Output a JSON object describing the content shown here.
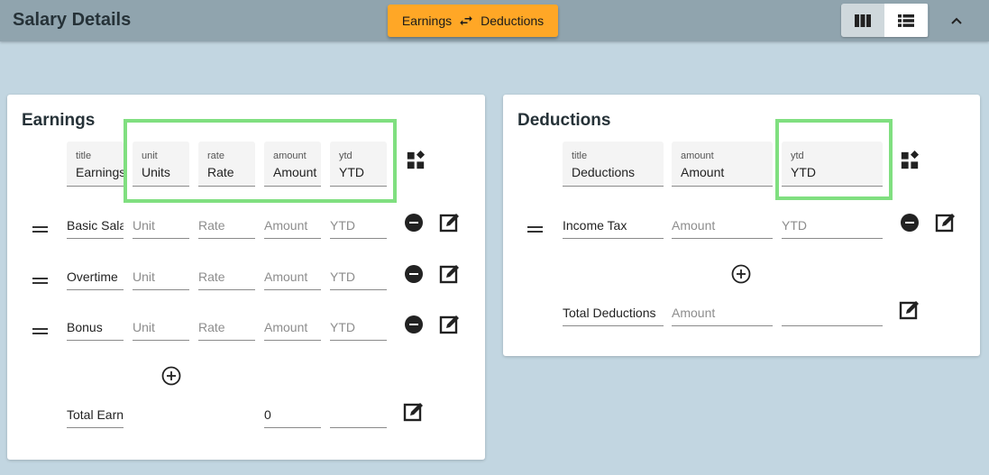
{
  "header": {
    "title": "Salary Details",
    "swap_button": {
      "left": "Earnings",
      "right": "Deductions"
    },
    "view_modes": [
      "columns",
      "list"
    ],
    "active_view": "columns"
  },
  "colors": {
    "accent": "#ffa726",
    "highlight": "#80df80",
    "topbar": "#90a4ae",
    "background": "#c2d6e1"
  },
  "earnings": {
    "title": "Earnings",
    "columns": [
      {
        "label": "title",
        "value": "Earnings"
      },
      {
        "label": "unit",
        "value": "Units"
      },
      {
        "label": "rate",
        "value": "Rate"
      },
      {
        "label": "amount",
        "value": "Amount"
      },
      {
        "label": "ytd",
        "value": "YTD"
      }
    ],
    "placeholders": {
      "unit": "Unit",
      "rate": "Rate",
      "amount": "Amount",
      "ytd": "YTD"
    },
    "rows": [
      {
        "title": "Basic Salary"
      },
      {
        "title": "Overtime"
      },
      {
        "title": "Bonus"
      }
    ],
    "total": {
      "title": "Total Earnings",
      "amount": "0",
      "ytd": ""
    }
  },
  "deductions": {
    "title": "Deductions",
    "columns": [
      {
        "label": "title",
        "value": "Deductions"
      },
      {
        "label": "amount",
        "value": "Amount"
      },
      {
        "label": "ytd",
        "value": "YTD"
      }
    ],
    "placeholders": {
      "amount": "Amount",
      "ytd": "YTD"
    },
    "rows": [
      {
        "title": "Income Tax"
      }
    ],
    "total": {
      "title": "Total Deductions",
      "amount_placeholder": "Amount",
      "ytd": ""
    }
  }
}
